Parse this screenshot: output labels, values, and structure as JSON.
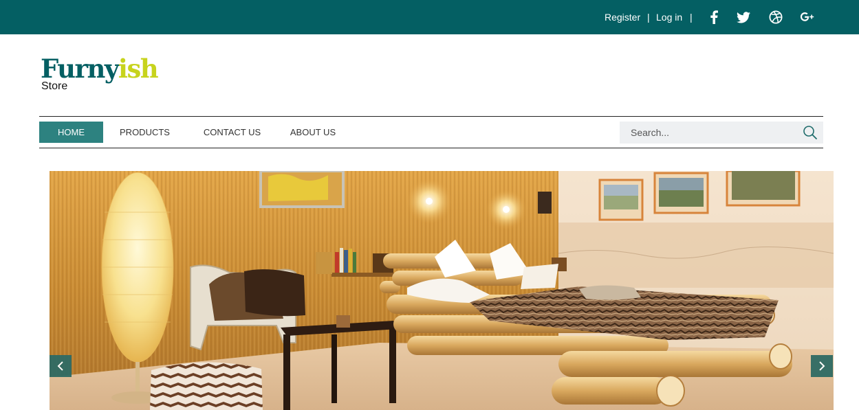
{
  "topbar": {
    "register_label": "Register",
    "separator": "|",
    "login_label": "Log in",
    "social_icons": [
      "facebook-icon",
      "twitter-icon",
      "dribbble-icon",
      "google-plus-icon"
    ]
  },
  "logo": {
    "name_part1": "Furny",
    "name_part2": "ish",
    "tagline": "Store"
  },
  "nav": {
    "items": [
      {
        "label": "HOME",
        "active": true
      },
      {
        "label": "PRODUCTS",
        "active": false
      },
      {
        "label": "CONTACT US",
        "active": false
      },
      {
        "label": "ABOUT US",
        "active": false
      }
    ]
  },
  "search": {
    "placeholder": "Search...",
    "value": ""
  },
  "hero": {
    "slider_prev_icon": "chevron-left-icon",
    "slider_next_icon": "chevron-right-icon"
  },
  "colors": {
    "brand": "#045f63",
    "accent_green": "#c7d31d",
    "nav_active": "#2d8280"
  }
}
